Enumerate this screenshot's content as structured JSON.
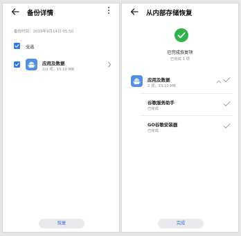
{
  "left": {
    "title": "备份详情",
    "backup_time": "备份时间：2019年9月14日 05:50",
    "select_all_label": "全选",
    "item": {
      "title": "应用及数据",
      "subtitle": "2/2 项，15.10 MB"
    },
    "button_label": "恢复",
    "icons": [
      "back-arrow-icon",
      "more-vertical-icon",
      "checkbox-checked-icon",
      "android-icon",
      "chevron-right-icon"
    ]
  },
  "right": {
    "title": "从内部存储恢复",
    "status_title": "已完成恢复项",
    "status_sub": "已完成 1 项",
    "group": {
      "title": "应用及数据",
      "subtitle": "2 项，15.10 MB"
    },
    "items": [
      {
        "title": "谷歌服务助手",
        "status": "已完成"
      },
      {
        "title": "GO谷歌安装器",
        "status": "已完成"
      }
    ],
    "button_label": "完成",
    "icons": [
      "back-arrow-icon",
      "success-check-icon",
      "android-icon",
      "chevron-up-icon",
      "check-icon"
    ]
  },
  "colors": {
    "accent_blue": "#2f7be6",
    "success_green": "#2fb34a",
    "muted_gray": "#8a8a8a",
    "button_bg": "#e9e9ee"
  }
}
